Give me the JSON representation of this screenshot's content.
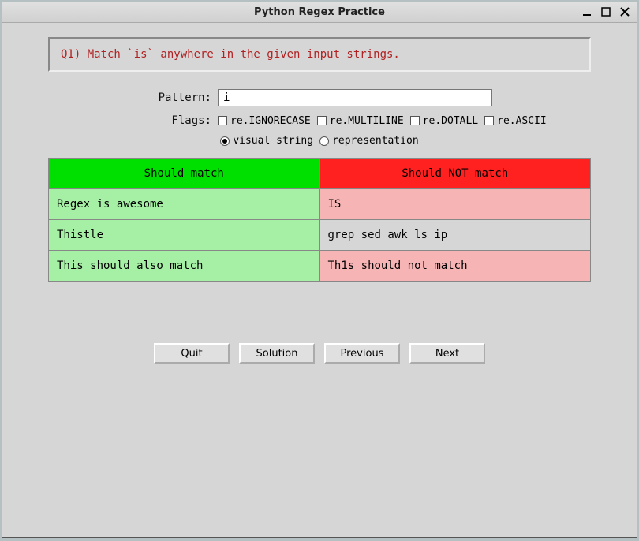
{
  "window": {
    "title": "Python Regex Practice"
  },
  "question": "Q1) Match `is` anywhere in the given input strings.",
  "labels": {
    "pattern": "Pattern:",
    "flags": "Flags:"
  },
  "pattern_value": "i",
  "flags": [
    {
      "label": "re.IGNORECASE",
      "checked": false
    },
    {
      "label": "re.MULTILINE",
      "checked": false
    },
    {
      "label": "re.DOTALL",
      "checked": false
    },
    {
      "label": "re.ASCII",
      "checked": false
    }
  ],
  "view_modes": [
    {
      "label": "visual string",
      "selected": true
    },
    {
      "label": "representation",
      "selected": false
    }
  ],
  "table": {
    "headers": {
      "match": "Should match",
      "nomatch": "Should NOT match"
    },
    "rows": [
      {
        "match": {
          "text": "Regex is awesome",
          "state": "green"
        },
        "nomatch": {
          "text": "IS",
          "state": "pink"
        }
      },
      {
        "match": {
          "text": "Thistle",
          "state": "green"
        },
        "nomatch": {
          "text": "grep sed awk ls ip",
          "state": "grey"
        }
      },
      {
        "match": {
          "text": "This should also match",
          "state": "green"
        },
        "nomatch": {
          "text": "Th1s should not match",
          "state": "pink"
        }
      }
    ]
  },
  "buttons": {
    "quit": "Quit",
    "solution": "Solution",
    "previous": "Previous",
    "next": "Next"
  },
  "colors": {
    "match_header": "#00e000",
    "nomatch_header": "#ff2020",
    "match_cell": "#a6f0a6",
    "nomatch_cell_fail": "#f7b4b4",
    "nomatch_cell_neutral": "#d6d6d6"
  }
}
